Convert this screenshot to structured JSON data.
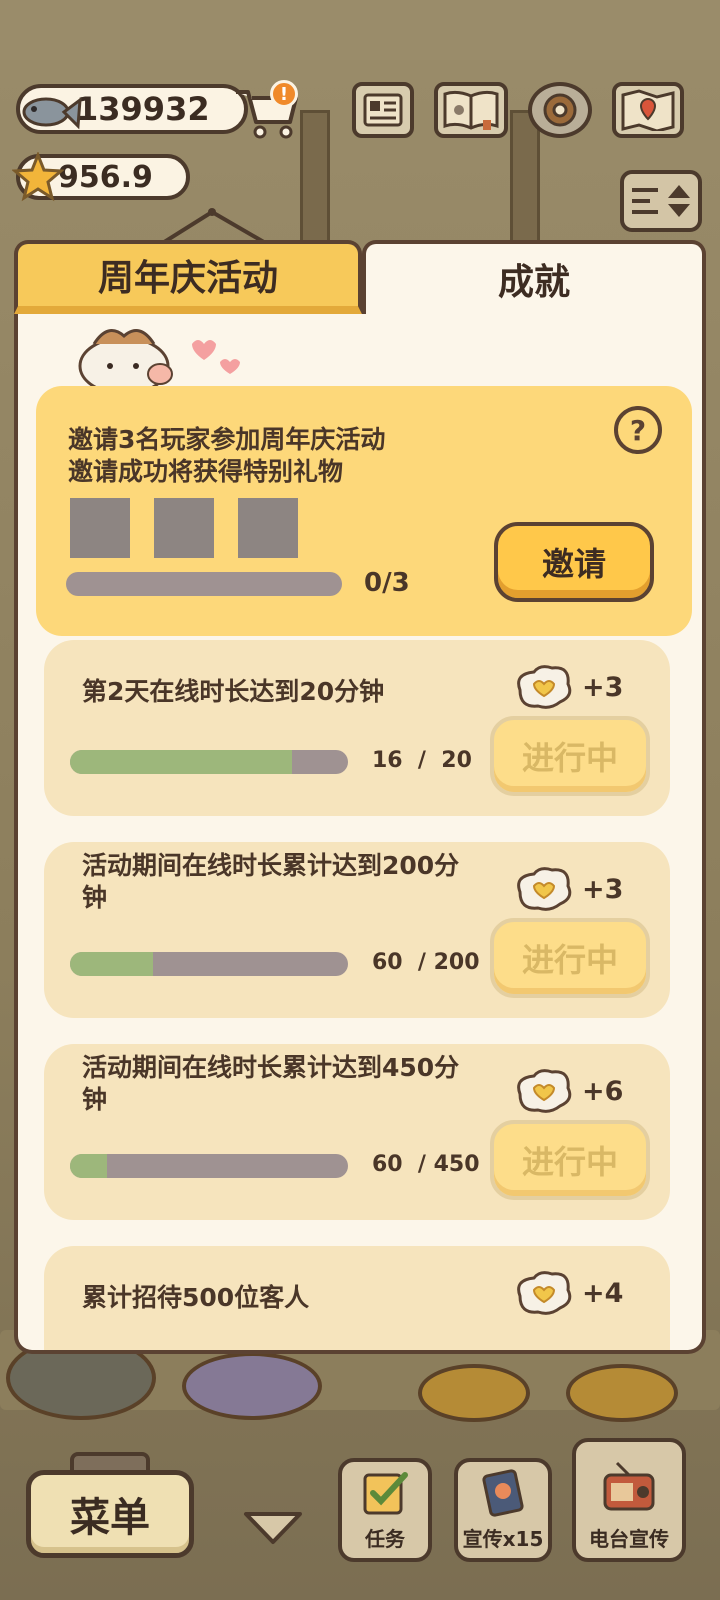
{
  "currency": {
    "fish": "139932",
    "star": "956.9"
  },
  "cart_badge": "!",
  "tabs": {
    "anniversary": "周年庆活动",
    "achievements": "成就"
  },
  "invite": {
    "line1": "邀请3名玩家参加周年庆活动",
    "line2": "邀请成功将获得特别礼物",
    "help": "?",
    "progress_text": "0/3",
    "progress_fraction": 0,
    "button": "邀请"
  },
  "tasks": [
    {
      "text": "第2天在线时长达到20分钟",
      "progress_text": "16  /  20",
      "current": 16,
      "total": 20,
      "reward": "+3",
      "button": "进行中"
    },
    {
      "text": "活动期间在线时长累计达到200分钟",
      "progress_text": "60  / 200",
      "current": 60,
      "total": 200,
      "reward": "+3",
      "button": "进行中"
    },
    {
      "text": "活动期间在线时长累计达到450分钟",
      "progress_text": "60  / 450",
      "current": 60,
      "total": 450,
      "reward": "+6",
      "button": "进行中"
    },
    {
      "text": "累计招待500位客人",
      "reward": "+4"
    }
  ],
  "bottom": {
    "menu": "菜单",
    "tasks": "任务",
    "promo": "宣传x15",
    "radio": "电台宣传"
  },
  "colors": {
    "progress_green": "#9db77b",
    "progress_track": "#9f9292",
    "tab_active": "#f7c95a",
    "invite_card": "#fdd87a"
  }
}
